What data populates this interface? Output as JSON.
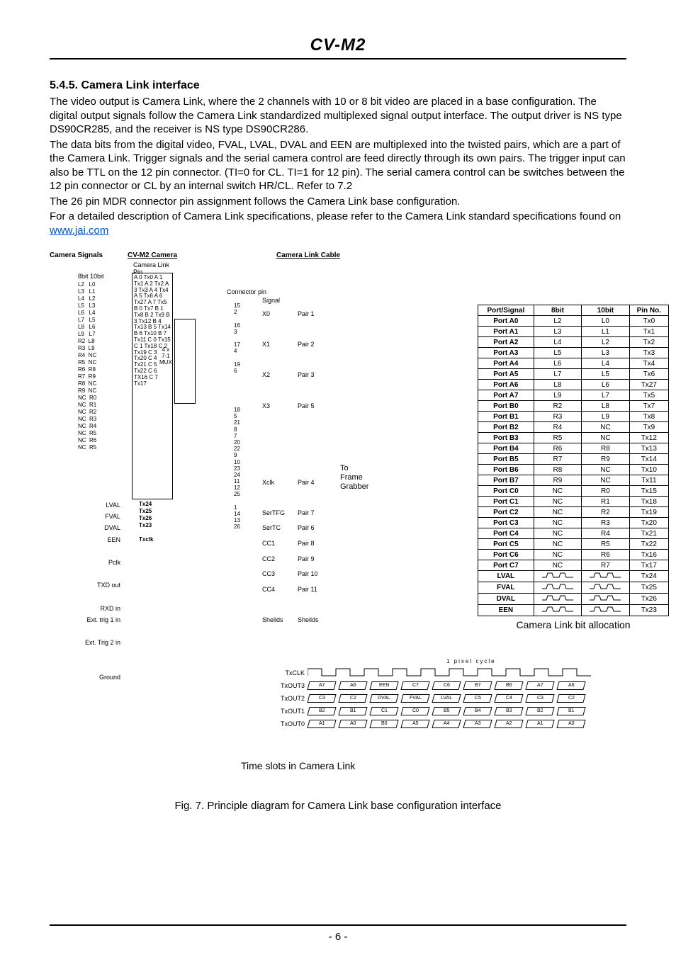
{
  "header": {
    "title": "CV-M2"
  },
  "section": {
    "heading": "5.4.5. Camera Link interface",
    "p1": "The video output is Camera Link, where the 2 channels with 10 or 8 bit video are placed in a base configuration. The digital output signals follow the Camera Link standardized multiplexed signal output interface. The output driver is NS type DS90CR285, and the receiver is NS type DS90CR286.",
    "p2": "The data bits from the digital video, FVAL, LVAL, DVAL and EEN are multiplexed into the twisted pairs, which are a part of the Camera Link. Trigger signals and the serial camera control are feed directly through its own pairs. The trigger input can also be TTL on the 12 pin connector. (TI=0 for CL. TI=1 for 12 pin). The serial camera control can be switches between the 12 pin connector or CL by an internal switch HR/CL. Refer to 7.2",
    "p3": "The 26 pin MDR connector pin assignment follows the Camera Link base configuration.",
    "p4a": "For a detailed description of Camera Link specifications, please refer to the Camera Link standard specifications found on ",
    "link_text": "www.jai.com",
    "link_href": "http://www.jai.com"
  },
  "diagram": {
    "camera_label": "CV-M2 Camera",
    "cable_label": "Camera Link Cable",
    "camera_signals": "Camera Signals",
    "bits_header": "8bit 10bit",
    "cl_pin": "Camera Link\nPin",
    "connector_pin": "Connector pin",
    "signal": "Signal",
    "to_frame_grabber": "To\nFrame\nGrabber",
    "mux_label": "4 x\n7-1\nMUX",
    "bit_lines": "L2   L0\nL3   L1\nL4   L2\nL5   L3\nL6   L4\nL7   L5\nL8   L6\nL9   L7\nR2  L8\nR3  L9\nR4  NC\nR5  NC\nR6  R8\nR7  R9\nR8  NC\nR9  NC\nNC  R0\nNC  R1\nNC  R2\nNC  R3\nNC  R4\nNC  R5\nNC  R6\nNC  R5",
    "pin_lines": "A 0   Tx0\nA 1   Tx1\nA 2   Tx2\nA 3   Tx3\nA 4   Tx4\nA 5   Tx6\nA 6   Tx27\nA 7   Tx5\nB 0   Tx7\nB 1   Tx8\nB 2   Tx9\nB 3   Tx12\nB 4   Tx13\nB 5   Tx14\nB 6   Tx10\nB 7   Tx11\nC 0   Tx15\nC 1   Tx18\nC 2   Tx19\nC 3   Tx20\nC 4   Tx21\nC 5   Tx22\nC 6   TX16\nC 7   Tx17",
    "side_signals": "LVAL\nFVAL\nDVAL\nEEN\n\nPclk\n\nTXD out\n\nRXD in\nExt. trig 1 in\n\nExt. Trig 2 in\n\n\nGround",
    "extra_tx": "Tx24\nTx25\nTx26\nTx23\n\nTxclk",
    "conn_numbers": "15\n2\n\n16\n3\n\n17\n4\n\n19\n6\n\n\n\n\n\n18\n5\n21\n8\n7\n20\n22\n9\n10\n23\n24\n11\n12\n25\n\n1\n14\n13\n26",
    "pair_sig": "X0\n\nX1\n\nX2\n\nX3\n\n\n\n\nXclk\n\nSerTFG\nSerTC\nCC1\nCC2\nCC3\nCC4\n\nSheilds",
    "pairs": "Pair 1\n\nPair 2\n\nPair 3\n\nPair 5\n\n\n\n\nPair 4\n\nPair 7\nPair 6\nPair 8\nPair 9\nPair 10\nPair 11\n\nSheilds"
  },
  "bit_table": {
    "caption": "Camera Link bit allocation",
    "headers": [
      "Port/Signal",
      "8bit",
      "10bit",
      "Pin No."
    ],
    "rows": [
      [
        "Port A0",
        "L2",
        "L0",
        "Tx0"
      ],
      [
        "Port A1",
        "L3",
        "L1",
        "Tx1"
      ],
      [
        "Port A2",
        "L4",
        "L2",
        "Tx2"
      ],
      [
        "Port A3",
        "L5",
        "L3",
        "Tx3"
      ],
      [
        "Port A4",
        "L6",
        "L4",
        "Tx4"
      ],
      [
        "Port A5",
        "L7",
        "L5",
        "Tx6"
      ],
      [
        "Port A6",
        "L8",
        "L6",
        "Tx27"
      ],
      [
        "Port A7",
        "L9",
        "L7",
        "Tx5"
      ],
      [
        "Port B0",
        "R2",
        "L8",
        "Tx7"
      ],
      [
        "Port B1",
        "R3",
        "L9",
        "Tx8"
      ],
      [
        "Port B2",
        "R4",
        "NC",
        "Tx9"
      ],
      [
        "Port B3",
        "R5",
        "NC",
        "Tx12"
      ],
      [
        "Port B4",
        "R6",
        "R8",
        "Tx13"
      ],
      [
        "Port B5",
        "R7",
        "R9",
        "Tx14"
      ],
      [
        "Port B6",
        "R8",
        "NC",
        "Tx10"
      ],
      [
        "Port B7",
        "R9",
        "NC",
        "Tx11"
      ],
      [
        "Port C0",
        "NC",
        "R0",
        "Tx15"
      ],
      [
        "Port C1",
        "NC",
        "R1",
        "Tx18"
      ],
      [
        "Port C2",
        "NC",
        "R2",
        "Tx19"
      ],
      [
        "Port C3",
        "NC",
        "R3",
        "Tx20"
      ],
      [
        "Port C4",
        "NC",
        "R4",
        "Tx21"
      ],
      [
        "Port C5",
        "NC",
        "R5",
        "Tx22"
      ],
      [
        "Port C6",
        "NC",
        "R6",
        "Tx16"
      ],
      [
        "Port C7",
        "NC",
        "R7",
        "Tx17"
      ],
      [
        "LVAL",
        "~",
        "~",
        "Tx24"
      ],
      [
        "FVAL",
        "~",
        "~",
        "Tx25"
      ],
      [
        "DVAL",
        "~",
        "~",
        "Tx26"
      ],
      [
        "EEN",
        "~",
        "~",
        "Tx23"
      ]
    ]
  },
  "timing": {
    "pixel_cycle": "1 pixel cycle",
    "rows": [
      {
        "label": "TxCLK",
        "cells": []
      },
      {
        "label": "TxOUT3",
        "cells": [
          "A7",
          "A6",
          "EEN",
          "C7",
          "C6",
          "B7",
          "B6",
          "A7",
          "A6"
        ]
      },
      {
        "label": "TxOUT2",
        "cells": [
          "C3",
          "C2",
          "DVAL",
          "FVAL",
          "LVAL",
          "C5",
          "C4",
          "C3",
          "C2"
        ]
      },
      {
        "label": "TxOUT1",
        "cells": [
          "B2",
          "B1",
          "C1",
          "C0",
          "B5",
          "B4",
          "B3",
          "B2",
          "B1"
        ]
      },
      {
        "label": "TxOUT0",
        "cells": [
          "A1",
          "A0",
          "B0",
          "A5",
          "A4",
          "A3",
          "A2",
          "A1",
          "A0"
        ]
      }
    ],
    "caption": "Time slots in Camera Link"
  },
  "figure_caption": "Fig. 7. Principle diagram for Camera Link base configuration interface",
  "footer": {
    "page_number": "- 6 -"
  }
}
